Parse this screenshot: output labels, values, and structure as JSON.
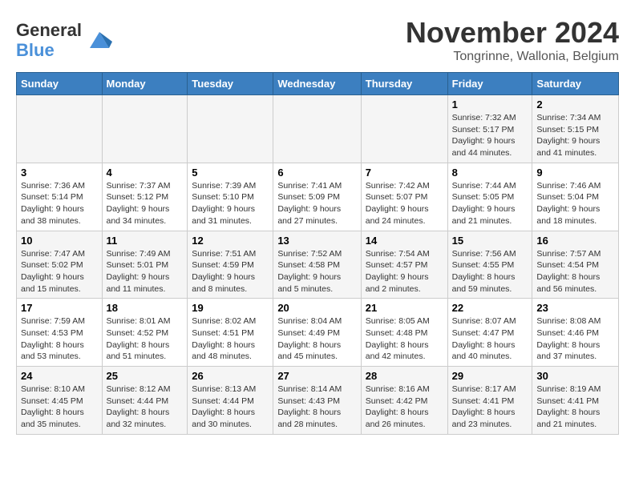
{
  "logo": {
    "line1": "General",
    "line2": "Blue"
  },
  "title": "November 2024",
  "location": "Tongrinne, Wallonia, Belgium",
  "days_of_week": [
    "Sunday",
    "Monday",
    "Tuesday",
    "Wednesday",
    "Thursday",
    "Friday",
    "Saturday"
  ],
  "weeks": [
    [
      {
        "day": "",
        "info": ""
      },
      {
        "day": "",
        "info": ""
      },
      {
        "day": "",
        "info": ""
      },
      {
        "day": "",
        "info": ""
      },
      {
        "day": "",
        "info": ""
      },
      {
        "day": "1",
        "info": "Sunrise: 7:32 AM\nSunset: 5:17 PM\nDaylight: 9 hours and 44 minutes."
      },
      {
        "day": "2",
        "info": "Sunrise: 7:34 AM\nSunset: 5:15 PM\nDaylight: 9 hours and 41 minutes."
      }
    ],
    [
      {
        "day": "3",
        "info": "Sunrise: 7:36 AM\nSunset: 5:14 PM\nDaylight: 9 hours and 38 minutes."
      },
      {
        "day": "4",
        "info": "Sunrise: 7:37 AM\nSunset: 5:12 PM\nDaylight: 9 hours and 34 minutes."
      },
      {
        "day": "5",
        "info": "Sunrise: 7:39 AM\nSunset: 5:10 PM\nDaylight: 9 hours and 31 minutes."
      },
      {
        "day": "6",
        "info": "Sunrise: 7:41 AM\nSunset: 5:09 PM\nDaylight: 9 hours and 27 minutes."
      },
      {
        "day": "7",
        "info": "Sunrise: 7:42 AM\nSunset: 5:07 PM\nDaylight: 9 hours and 24 minutes."
      },
      {
        "day": "8",
        "info": "Sunrise: 7:44 AM\nSunset: 5:05 PM\nDaylight: 9 hours and 21 minutes."
      },
      {
        "day": "9",
        "info": "Sunrise: 7:46 AM\nSunset: 5:04 PM\nDaylight: 9 hours and 18 minutes."
      }
    ],
    [
      {
        "day": "10",
        "info": "Sunrise: 7:47 AM\nSunset: 5:02 PM\nDaylight: 9 hours and 15 minutes."
      },
      {
        "day": "11",
        "info": "Sunrise: 7:49 AM\nSunset: 5:01 PM\nDaylight: 9 hours and 11 minutes."
      },
      {
        "day": "12",
        "info": "Sunrise: 7:51 AM\nSunset: 4:59 PM\nDaylight: 9 hours and 8 minutes."
      },
      {
        "day": "13",
        "info": "Sunrise: 7:52 AM\nSunset: 4:58 PM\nDaylight: 9 hours and 5 minutes."
      },
      {
        "day": "14",
        "info": "Sunrise: 7:54 AM\nSunset: 4:57 PM\nDaylight: 9 hours and 2 minutes."
      },
      {
        "day": "15",
        "info": "Sunrise: 7:56 AM\nSunset: 4:55 PM\nDaylight: 8 hours and 59 minutes."
      },
      {
        "day": "16",
        "info": "Sunrise: 7:57 AM\nSunset: 4:54 PM\nDaylight: 8 hours and 56 minutes."
      }
    ],
    [
      {
        "day": "17",
        "info": "Sunrise: 7:59 AM\nSunset: 4:53 PM\nDaylight: 8 hours and 53 minutes."
      },
      {
        "day": "18",
        "info": "Sunrise: 8:01 AM\nSunset: 4:52 PM\nDaylight: 8 hours and 51 minutes."
      },
      {
        "day": "19",
        "info": "Sunrise: 8:02 AM\nSunset: 4:51 PM\nDaylight: 8 hours and 48 minutes."
      },
      {
        "day": "20",
        "info": "Sunrise: 8:04 AM\nSunset: 4:49 PM\nDaylight: 8 hours and 45 minutes."
      },
      {
        "day": "21",
        "info": "Sunrise: 8:05 AM\nSunset: 4:48 PM\nDaylight: 8 hours and 42 minutes."
      },
      {
        "day": "22",
        "info": "Sunrise: 8:07 AM\nSunset: 4:47 PM\nDaylight: 8 hours and 40 minutes."
      },
      {
        "day": "23",
        "info": "Sunrise: 8:08 AM\nSunset: 4:46 PM\nDaylight: 8 hours and 37 minutes."
      }
    ],
    [
      {
        "day": "24",
        "info": "Sunrise: 8:10 AM\nSunset: 4:45 PM\nDaylight: 8 hours and 35 minutes."
      },
      {
        "day": "25",
        "info": "Sunrise: 8:12 AM\nSunset: 4:44 PM\nDaylight: 8 hours and 32 minutes."
      },
      {
        "day": "26",
        "info": "Sunrise: 8:13 AM\nSunset: 4:44 PM\nDaylight: 8 hours and 30 minutes."
      },
      {
        "day": "27",
        "info": "Sunrise: 8:14 AM\nSunset: 4:43 PM\nDaylight: 8 hours and 28 minutes."
      },
      {
        "day": "28",
        "info": "Sunrise: 8:16 AM\nSunset: 4:42 PM\nDaylight: 8 hours and 26 minutes."
      },
      {
        "day": "29",
        "info": "Sunrise: 8:17 AM\nSunset: 4:41 PM\nDaylight: 8 hours and 23 minutes."
      },
      {
        "day": "30",
        "info": "Sunrise: 8:19 AM\nSunset: 4:41 PM\nDaylight: 8 hours and 21 minutes."
      }
    ]
  ]
}
